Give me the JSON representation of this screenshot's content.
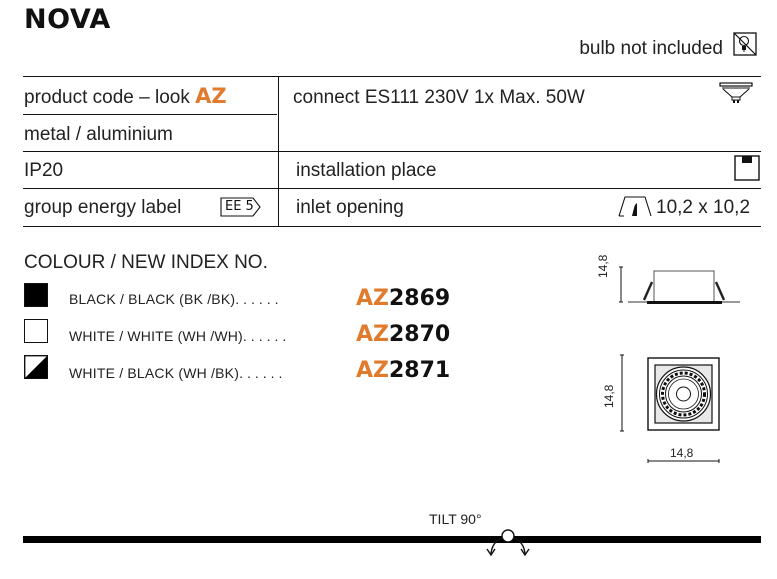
{
  "header": {
    "title": "NOVA",
    "bulb_note": "bulb not included",
    "bulb_icon": "bulb-crossed-icon"
  },
  "specs": {
    "product_code_label": "product code – look ",
    "product_code_prefix": "AZ",
    "material": "metal / aluminium",
    "connect": "connect ES111 230V 1x Max. 50W",
    "connect_icon": "es111-lamp-icon",
    "ip_rating": "IP20",
    "installation_label": "installation place",
    "installation_icon": "ceiling-mount-icon",
    "energy_label": "group energy label",
    "energy_badge": "EE 5",
    "inlet_label": "inlet opening",
    "inlet_icon": "ceiling-cutout-icon",
    "inlet_value": "10,2 x 10,2"
  },
  "colours": {
    "title": "COLOUR / NEW INDEX NO.",
    "items": [
      {
        "swatch": "black",
        "label": "BLACK / BLACK (BK /BK)",
        "dots": "......",
        "prefix": "AZ",
        "number": "2869"
      },
      {
        "swatch": "white",
        "label": "WHITE / WHITE (WH /WH)",
        "dots": "......",
        "prefix": "AZ",
        "number": "2870"
      },
      {
        "swatch": "white-black",
        "label": "WHITE / BLACK (WH /BK)",
        "dots": "......",
        "prefix": "AZ",
        "number": "2871"
      }
    ]
  },
  "drawings": {
    "side_height": "14,8",
    "front_height": "14,8",
    "front_width": "14,8"
  },
  "footer": {
    "tilt_label": "TILT 90°"
  },
  "colors": {
    "accent": "#e07b2e",
    "text": "#222222",
    "line": "#111111"
  }
}
